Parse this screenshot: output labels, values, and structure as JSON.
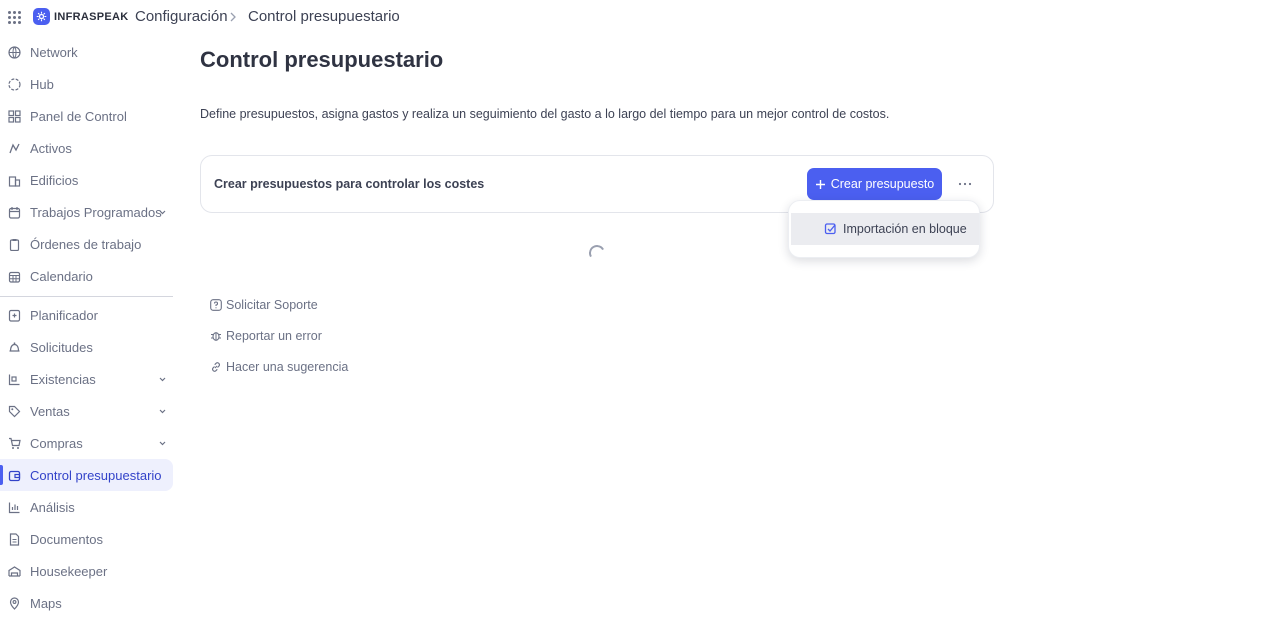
{
  "header": {
    "logo_text": "INFRASPEAK",
    "breadcrumb": [
      "Configuración",
      "Control presupuestario"
    ]
  },
  "sidebar": {
    "items": [
      {
        "label": "Network",
        "icon": "globe-icon"
      },
      {
        "label": "Hub",
        "icon": "hub-icon"
      },
      {
        "label": "Panel de Control",
        "icon": "dashboard-icon"
      },
      {
        "label": "Activos",
        "icon": "assets-icon"
      },
      {
        "label": "Edificios",
        "icon": "building-icon"
      },
      {
        "label": "Trabajos Programados",
        "icon": "calendar-check-icon",
        "has_submenu": true
      },
      {
        "label": "Órdenes de trabajo",
        "icon": "clipboard-icon"
      },
      {
        "label": "Calendario",
        "icon": "calendar-icon"
      },
      {
        "label": "Planificador",
        "icon": "planner-icon"
      },
      {
        "label": "Solicitudes",
        "icon": "bell-icon"
      },
      {
        "label": "Existencias",
        "icon": "stock-icon",
        "has_submenu": true
      },
      {
        "label": "Ventas",
        "icon": "tag-icon",
        "has_submenu": true
      },
      {
        "label": "Compras",
        "icon": "cart-icon",
        "has_submenu": true
      },
      {
        "label": "Control presupuestario",
        "icon": "wallet-icon",
        "active": true
      },
      {
        "label": "Análisis",
        "icon": "bar-chart-icon"
      },
      {
        "label": "Documentos",
        "icon": "document-icon"
      },
      {
        "label": "Housekeeper",
        "icon": "bed-icon"
      },
      {
        "label": "Maps",
        "icon": "map-pin-icon"
      }
    ]
  },
  "main": {
    "title": "Control presupuestario",
    "description": "Define presupuestos, asigna gastos y realiza un seguimiento del gasto a lo largo del tiempo para un mejor control de costos.",
    "card": {
      "text": "Crear presupuestos para controlar los costes",
      "primary_button": "Crear presupuesto"
    },
    "dropdown": {
      "items": [
        "Importación en bloque"
      ]
    },
    "help_links": [
      "Solicitar Soporte",
      "Reportar un error",
      "Hacer una sugerencia"
    ]
  },
  "colors": {
    "accent": "#4b5ff0",
    "active_bg": "#eef0fd",
    "text": "#3d4254",
    "muted": "#6b7185"
  }
}
